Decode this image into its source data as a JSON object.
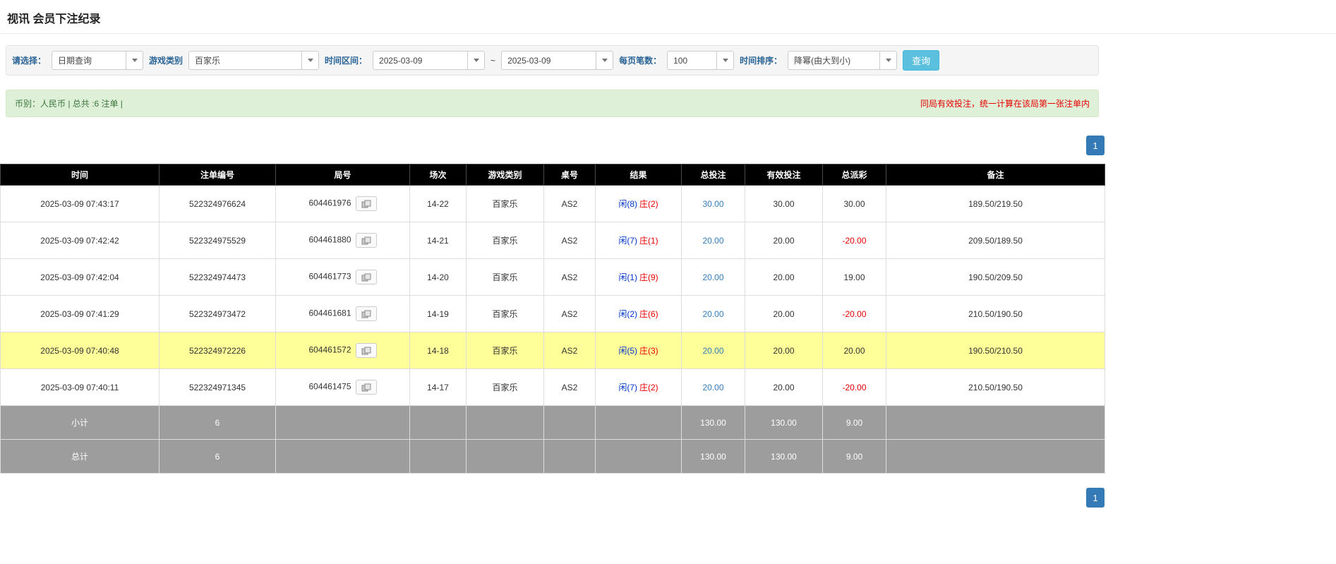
{
  "page": {
    "title": "视讯 会员下注纪录"
  },
  "filters": {
    "select_label": "请选择：",
    "select_value": "日期查询",
    "game_type_label": "游戏类别",
    "game_type_value": "百家乐",
    "time_range_label": "时间区间：",
    "time_from": "2025-03-09",
    "time_separator": "~",
    "time_to": "2025-03-09",
    "per_page_label": "每页笔数：",
    "per_page_value": "100",
    "sort_label": "时间排序：",
    "sort_value": "降幂(由大到小)",
    "search_button": "查询"
  },
  "info_bar": {
    "left": "币别：人民币 | 总共 :6 注单 |",
    "right": "同局有效投注，统一计算在该局第一张注单内"
  },
  "pagination": {
    "page": "1"
  },
  "table": {
    "headers": [
      "时间",
      "注单编号",
      "局号",
      "场次",
      "游戏类别",
      "桌号",
      "结果",
      "总投注",
      "有效投注",
      "总派彩",
      "备注"
    ],
    "rows": [
      {
        "time": "2025-03-09 07:43:17",
        "bet_id": "522324976624",
        "round_id": "604461976",
        "session": "14-22",
        "game": "百家乐",
        "table_no": "AS2",
        "result_player": "闲(8)",
        "result_banker": "庄(2)",
        "total_bet": "30.00",
        "valid_bet": "30.00",
        "payout": "30.00",
        "negative": false,
        "highlight": false,
        "note": "189.50/219.50"
      },
      {
        "time": "2025-03-09 07:42:42",
        "bet_id": "522324975529",
        "round_id": "604461880",
        "session": "14-21",
        "game": "百家乐",
        "table_no": "AS2",
        "result_player": "闲(7)",
        "result_banker": "庄(1)",
        "total_bet": "20.00",
        "valid_bet": "20.00",
        "payout": "-20.00",
        "negative": true,
        "highlight": false,
        "note": "209.50/189.50"
      },
      {
        "time": "2025-03-09 07:42:04",
        "bet_id": "522324974473",
        "round_id": "604461773",
        "session": "14-20",
        "game": "百家乐",
        "table_no": "AS2",
        "result_player": "闲(1)",
        "result_banker": "庄(9)",
        "total_bet": "20.00",
        "valid_bet": "20.00",
        "payout": "19.00",
        "negative": false,
        "highlight": false,
        "note": "190.50/209.50"
      },
      {
        "time": "2025-03-09 07:41:29",
        "bet_id": "522324973472",
        "round_id": "604461681",
        "session": "14-19",
        "game": "百家乐",
        "table_no": "AS2",
        "result_player": "闲(2)",
        "result_banker": "庄(6)",
        "total_bet": "20.00",
        "valid_bet": "20.00",
        "payout": "-20.00",
        "negative": true,
        "highlight": false,
        "note": "210.50/190.50"
      },
      {
        "time": "2025-03-09 07:40:48",
        "bet_id": "522324972226",
        "round_id": "604461572",
        "session": "14-18",
        "game": "百家乐",
        "table_no": "AS2",
        "result_player": "闲(5)",
        "result_banker": "庄(3)",
        "total_bet": "20.00",
        "valid_bet": "20.00",
        "payout": "20.00",
        "negative": false,
        "highlight": true,
        "note": "190.50/210.50"
      },
      {
        "time": "2025-03-09 07:40:11",
        "bet_id": "522324971345",
        "round_id": "604461475",
        "session": "14-17",
        "game": "百家乐",
        "table_no": "AS2",
        "result_player": "闲(7)",
        "result_banker": "庄(2)",
        "total_bet": "20.00",
        "valid_bet": "20.00",
        "payout": "-20.00",
        "negative": true,
        "highlight": false,
        "note": "210.50/190.50"
      }
    ],
    "subtotal": {
      "label": "小计",
      "count": "6",
      "total_bet": "130.00",
      "valid_bet": "130.00",
      "payout": "9.00"
    },
    "total": {
      "label": "总计",
      "count": "6",
      "total_bet": "130.00",
      "valid_bet": "130.00",
      "payout": "9.00"
    }
  },
  "colors": {
    "header_bg": "#000000",
    "footer_bg": "#9d9d9d",
    "highlight_yellow": "#ffff99",
    "link_blue": "#337ab7",
    "player_blue": "#0033cc",
    "banker_red": "#e60000",
    "negative_red": "#e60000",
    "label_blue": "#2a6496",
    "search_button_bg": "#5bc0de",
    "info_bg": "#dff0d8",
    "info_text": "#3c763d",
    "notice_red": "#e60000"
  }
}
